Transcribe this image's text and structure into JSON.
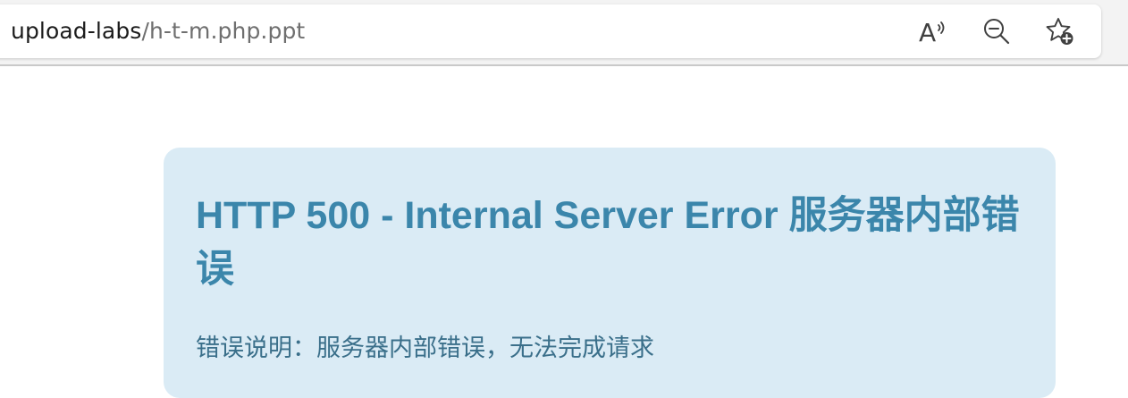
{
  "browser": {
    "address_bar": {
      "host": "upload-labs",
      "path": "/h-t-m.php.ppt"
    },
    "toolbar": {
      "read_aloud_icon": "read-aloud-icon",
      "zoom_out_icon": "zoom-out-icon",
      "add_favorite_icon": "add-favorite-icon"
    }
  },
  "page": {
    "error_title": "HTTP 500 - Internal Server Error 服务器内部错误",
    "error_description": "错误说明：服务器内部错误，无法完成请求"
  },
  "colors": {
    "card_background": "#daebf5",
    "title_color": "#3b86ab",
    "description_color": "#3a6f8a"
  }
}
